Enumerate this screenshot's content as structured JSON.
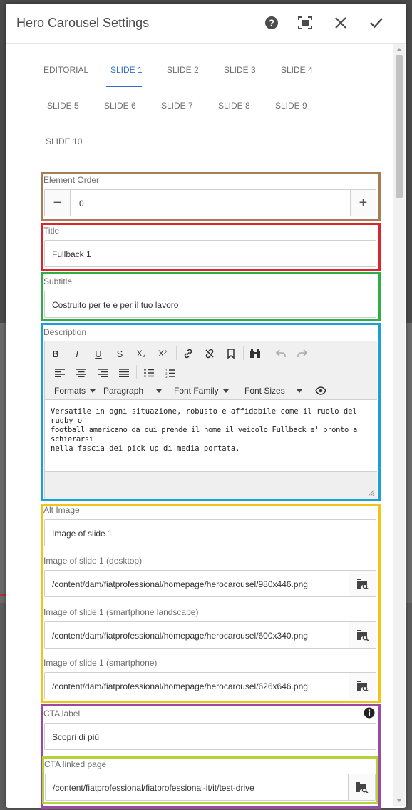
{
  "dialog": {
    "title": "Hero Carousel Settings",
    "icons": [
      "help-icon",
      "fullscreen-icon",
      "close-icon",
      "check-icon"
    ]
  },
  "tabs": [
    {
      "label": "EDITORIAL",
      "active": false
    },
    {
      "label": "SLIDE 1",
      "active": true
    },
    {
      "label": "SLIDE 2",
      "active": false
    },
    {
      "label": "SLIDE 3",
      "active": false
    },
    {
      "label": "SLIDE 4",
      "active": false
    },
    {
      "label": "SLIDE 5",
      "active": false
    },
    {
      "label": "SLIDE 6",
      "active": false
    },
    {
      "label": "SLIDE 7",
      "active": false
    },
    {
      "label": "SLIDE 8",
      "active": false
    },
    {
      "label": "SLIDE 9",
      "active": false
    },
    {
      "label": "SLIDE 10",
      "active": false
    }
  ],
  "element_order": {
    "label": "Element Order",
    "value": "0",
    "minus": "−",
    "plus": "+"
  },
  "title_field": {
    "label": "Title",
    "value": "Fullback 1"
  },
  "subtitle_field": {
    "label": "Subtitle",
    "value": "Costruito per te e per il tuo lavoro"
  },
  "description": {
    "label": "Description",
    "toolbar": {
      "bold": "B",
      "italic": "I",
      "underline": "U",
      "strike": "S",
      "subscript": "X₂",
      "superscript": "X²",
      "formats": "Formats",
      "paragraph": "Paragraph",
      "font_family": "Font Family",
      "font_sizes": "Font Sizes"
    },
    "lines": [
      "Versatile in ogni situazione, robusto e affidabile come il ruolo del rugby o",
      "football americano da cui prende il nome il veicolo Fullback e' pronto a schierarsi",
      "nella fascia dei pick up di media portata."
    ]
  },
  "images": {
    "alt_label": "Alt Image",
    "alt_value": "Image of slide 1",
    "desktop_label": "Image of slide 1 (desktop)",
    "desktop_value": "/content/dam/fiatprofessional/homepage/herocarousel/980x446.png",
    "landscape_label": "Image of slide 1 (smartphone landscape)",
    "landscape_value": "/content/dam/fiatprofessional/homepage/herocarousel/600x340.png",
    "smartphone_label": "Image of slide 1 (smartphone)",
    "smartphone_value": "/content/dam/fiatprofessional/homepage/herocarousel/626x646.png"
  },
  "cta": {
    "label_label": "CTA label",
    "label_value": "Scopri di più",
    "page_label": "CTA linked page",
    "page_value": "/content/fiatprofessional/fiatprofessional-it/it/test-drive"
  },
  "colors": {
    "element_order_border": "#a87d55",
    "title_border": "#d9252d",
    "subtitle_border": "#2fae48",
    "description_border": "#1a9fd9",
    "images_border": "#f2c418",
    "cta_border": "#9b4aa3",
    "cta_page_border": "#b4d23a",
    "accent": "#326ec8"
  }
}
